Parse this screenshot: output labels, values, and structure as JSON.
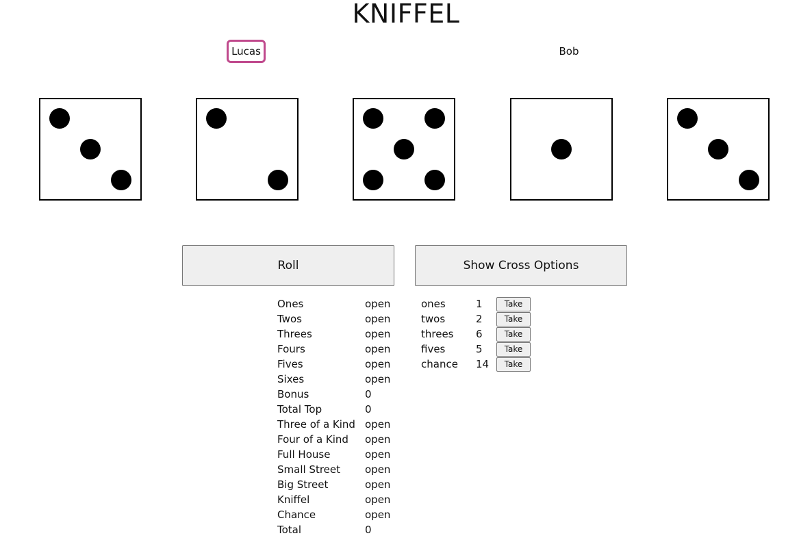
{
  "title": "KNIFFEL",
  "players": [
    {
      "name": "Lucas",
      "active": true
    },
    {
      "name": "Bob",
      "active": false
    }
  ],
  "dice": [
    3,
    2,
    5,
    1,
    3
  ],
  "buttons": {
    "roll": "Roll",
    "cross": "Show Cross Options"
  },
  "scorecard": [
    {
      "label": "Ones",
      "value": "open"
    },
    {
      "label": "Twos",
      "value": "open"
    },
    {
      "label": "Threes",
      "value": "open"
    },
    {
      "label": "Fours",
      "value": "open"
    },
    {
      "label": "Fives",
      "value": "open"
    },
    {
      "label": "Sixes",
      "value": "open"
    },
    {
      "label": "Bonus",
      "value": "0"
    },
    {
      "label": "Total Top",
      "value": "0"
    },
    {
      "label": "Three of a Kind",
      "value": "open"
    },
    {
      "label": "Four of a Kind",
      "value": "open"
    },
    {
      "label": "Full House",
      "value": "open"
    },
    {
      "label": "Small Street",
      "value": "open"
    },
    {
      "label": "Big Street",
      "value": "open"
    },
    {
      "label": "Kniffel",
      "value": "open"
    },
    {
      "label": "Chance",
      "value": "open"
    },
    {
      "label": "Total",
      "value": "0"
    }
  ],
  "options": [
    {
      "name": "ones",
      "points": "1",
      "action": "Take"
    },
    {
      "name": "twos",
      "points": "2",
      "action": "Take"
    },
    {
      "name": "threes",
      "points": "6",
      "action": "Take"
    },
    {
      "name": "fives",
      "points": "5",
      "action": "Take"
    },
    {
      "name": "chance",
      "points": "14",
      "action": "Take"
    }
  ],
  "colors": {
    "active_player_border": "#c04a8d",
    "button_bg": "#efefef",
    "button_border": "#767676"
  }
}
